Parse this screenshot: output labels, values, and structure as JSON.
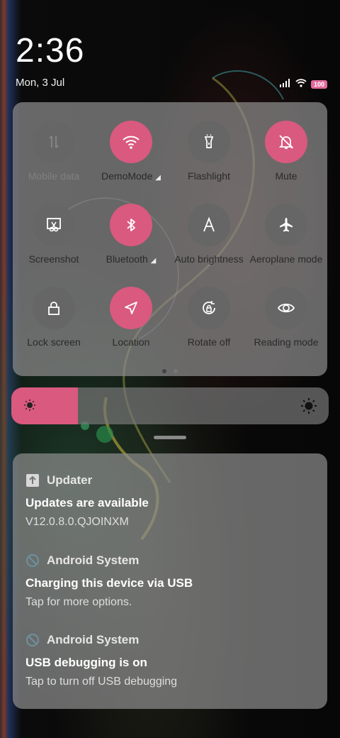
{
  "status": {
    "time": "2:36",
    "date": "Mon, 3 Jul",
    "battery": "100",
    "icons": [
      "signal-icon",
      "wifi-icon",
      "battery-icon"
    ]
  },
  "quick_settings": {
    "tiles": [
      {
        "label": "Mobile data",
        "icon": "mobile-data-icon",
        "active": false,
        "disabled": true
      },
      {
        "label": "DemoMode",
        "icon": "wifi-icon",
        "active": true,
        "expandable": true
      },
      {
        "label": "Flashlight",
        "icon": "flashlight-icon",
        "active": false
      },
      {
        "label": "Mute",
        "icon": "bell-off-icon",
        "active": true
      },
      {
        "label": "Screenshot",
        "icon": "screenshot-icon",
        "active": false
      },
      {
        "label": "Bluetooth",
        "icon": "bluetooth-icon",
        "active": true,
        "expandable": true
      },
      {
        "label": "Auto brightness",
        "icon": "auto-brightness-icon",
        "active": false
      },
      {
        "label": "Aeroplane mode",
        "icon": "airplane-icon",
        "active": false
      },
      {
        "label": "Lock screen",
        "icon": "lock-icon",
        "active": false
      },
      {
        "label": "Location",
        "icon": "location-icon",
        "active": true
      },
      {
        "label": "Rotate off",
        "icon": "rotate-lock-icon",
        "active": false
      },
      {
        "label": "Reading mode",
        "icon": "eye-icon",
        "active": false
      }
    ],
    "page_count": 2,
    "current_page": 1
  },
  "brightness": {
    "level": 0.21
  },
  "notifications": [
    {
      "app": "Updater",
      "icon": "updater-icon",
      "title": "Updates are available",
      "body": "V12.0.8.0.QJOINXM"
    },
    {
      "app": "Android System",
      "icon": "android-system-icon",
      "title": "Charging this device via USB",
      "body": "Tap for more options."
    },
    {
      "app": "Android System",
      "icon": "android-system-icon",
      "title": "USB debugging is on",
      "body": "Tap to turn off USB debugging"
    }
  ],
  "colors": {
    "accent": "#d9597f",
    "tile_off": "#666666",
    "panel": "#8c8c8c"
  }
}
